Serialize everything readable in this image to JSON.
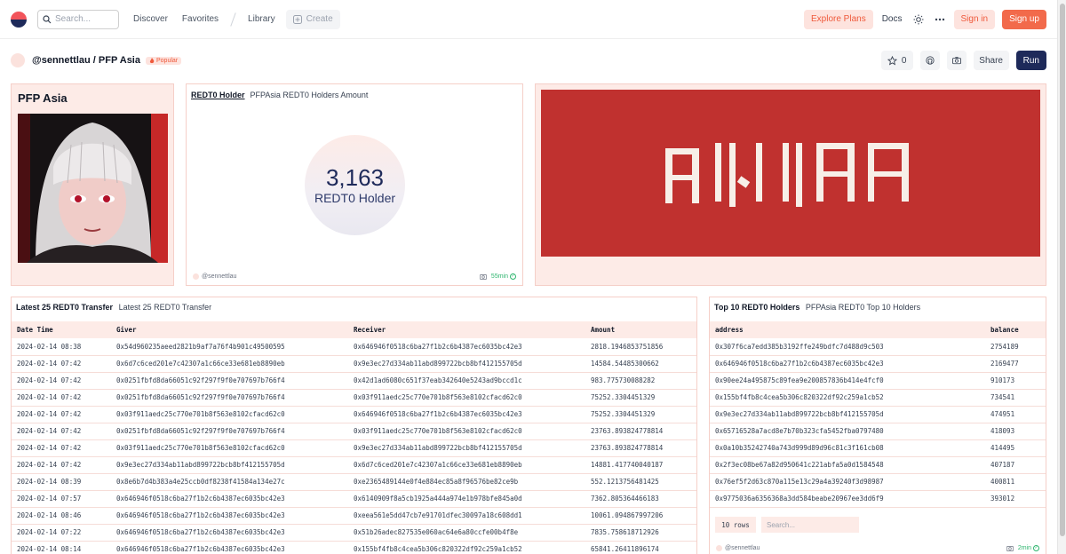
{
  "nav": {
    "search_placeholder": "Search...",
    "discover": "Discover",
    "favorites": "Favorites",
    "library": "Library",
    "create": "Create",
    "explore_plans": "Explore Plans",
    "docs": "Docs",
    "sign_in": "Sign in",
    "sign_up": "Sign up"
  },
  "subheader": {
    "breadcrumb": "@sennettlau / PFP Asia",
    "badge": "Popular",
    "star_count": "0",
    "share": "Share",
    "run": "Run"
  },
  "pfp_card": {
    "title": "PFP Asia"
  },
  "holder_card": {
    "title": "REDT0 Holder",
    "subtitle": "PFPAsia REDT0 Holders Amount",
    "value": "3,163",
    "label": "REDT0 Holder",
    "author": "@sennettlau",
    "time": "55min"
  },
  "banner": {
    "text": "ASIA",
    "color": "#c0312f"
  },
  "transfers": {
    "title": "Latest 25 REDT0 Transfer",
    "subtitle": "Latest 25 REDT0 Transfer",
    "columns": [
      "Date Time",
      "Giver",
      "Receiver",
      "Amount"
    ],
    "rows": [
      [
        "2024-02-14 08:38",
        "0x54d960235aeed2821b9af7a76f4b901c49500595",
        "0x646946f0518c6ba27f1b2c6b4387ec6035bc42e3",
        "2818.1946853751856"
      ],
      [
        "2024-02-14 07:42",
        "0x6d7c6ced201e7c42307a1c66ce33e681eb8890eb",
        "0x9e3ec27d334ab11abd899722bcb8bf412155705d",
        "14584.54485300662"
      ],
      [
        "2024-02-14 07:42",
        "0x0251fbfd8da66051c92f297f9f0e707697b766f4",
        "0x42d1ad6080c651f37eab342640e5243ad9bccd1c",
        "983.775730088282"
      ],
      [
        "2024-02-14 07:42",
        "0x0251fbfd8da66051c92f297f9f0e707697b766f4",
        "0x03f911aedc25c770e701b8f563e8102cfacd62c0",
        "75252.3304451329"
      ],
      [
        "2024-02-14 07:42",
        "0x03f911aedc25c770e701b8f563e8102cfacd62c0",
        "0x646946f0518c6ba27f1b2c6b4387ec6035bc42e3",
        "75252.3304451329"
      ],
      [
        "2024-02-14 07:42",
        "0x0251fbfd8da66051c92f297f9f0e707697b766f4",
        "0x03f911aedc25c770e701b8f563e8102cfacd62c0",
        "23763.893824778814"
      ],
      [
        "2024-02-14 07:42",
        "0x03f911aedc25c770e701b8f563e8102cfacd62c0",
        "0x9e3ec27d334ab11abd899722bcb8bf412155705d",
        "23763.893824778814"
      ],
      [
        "2024-02-14 07:42",
        "0x9e3ec27d334ab11abd899722bcb8bf412155705d",
        "0x6d7c6ced201e7c42307a1c66ce33e681eb8890eb",
        "14881.417740040187"
      ],
      [
        "2024-02-14 08:39",
        "0x8e6b7d4b383a4e25ccb0df8238f41584a134e27c",
        "0xe2365489144e0f4e884ec85a8f96576be82ce9b",
        "552.1213756481425"
      ],
      [
        "2024-02-14 07:57",
        "0x646946f0518c6ba27f1b2c6b4387ec6035bc42e3",
        "0x6140909f8a5cb1925a444a974e1b978bfe845a0d",
        "7362.805364466183"
      ],
      [
        "2024-02-14 08:46",
        "0x646946f0518c6ba27f1b2c6b4387ec6035bc42e3",
        "0xeea561e5dd47cb7e91701dfec30097a18c608dd1",
        "10061.094867997206"
      ],
      [
        "2024-02-14 07:22",
        "0x646946f0518c6ba27f1b2c6b4387ec6035bc42e3",
        "0x51b26adec827535e060ac64e6a80ccfe00b4f8e",
        "7835.758618712926"
      ],
      [
        "2024-02-14 08:14",
        "0x646946f0518c6ba27f1b2c6b4387ec6035bc42e3",
        "0x155bf4fb8c4cea5b306c820322df92c259a1cb52",
        "65841.26411896174"
      ]
    ]
  },
  "top_holders": {
    "title": "Top 10 REDT0 Holders",
    "subtitle": "PFPAsia REDT0 Top 10 Holders",
    "columns": [
      "address",
      "balance"
    ],
    "rows": [
      [
        "0x307f6ca7edd385b3192ffe249bdfc7d488d9c503",
        "2754189"
      ],
      [
        "0x646946f0518c6ba27f1b2c6b4387ec6035bc42e3",
        "2169477"
      ],
      [
        "0x90ee24a495875c89fea9e200857836b414e4fcf0",
        "910173"
      ],
      [
        "0x155bf4fb8c4cea5b306c820322df92c259a1cb52",
        "734541"
      ],
      [
        "0x9e3ec27d334ab11abd899722bcb8bf412155705d",
        "474951"
      ],
      [
        "0x65716528a7acd8e7b70b323cfa5452fba0797480",
        "418093"
      ],
      [
        "0x0a10b35242740a743d999d89d96c81c3f161cb08",
        "414495"
      ],
      [
        "0x2f3ec08be67a82d950641c221abfa5a0d1584548",
        "407187"
      ],
      [
        "0x76ef5f2d63c870a115e13c29a4a39240f3d98987",
        "400811"
      ],
      [
        "0x9775036a6356368a3dd584beabe20967ee3dd6f9",
        "393012"
      ]
    ],
    "rows_label": "10 rows",
    "search_placeholder": "Search...",
    "author": "@sennettlau",
    "time": "2min"
  }
}
